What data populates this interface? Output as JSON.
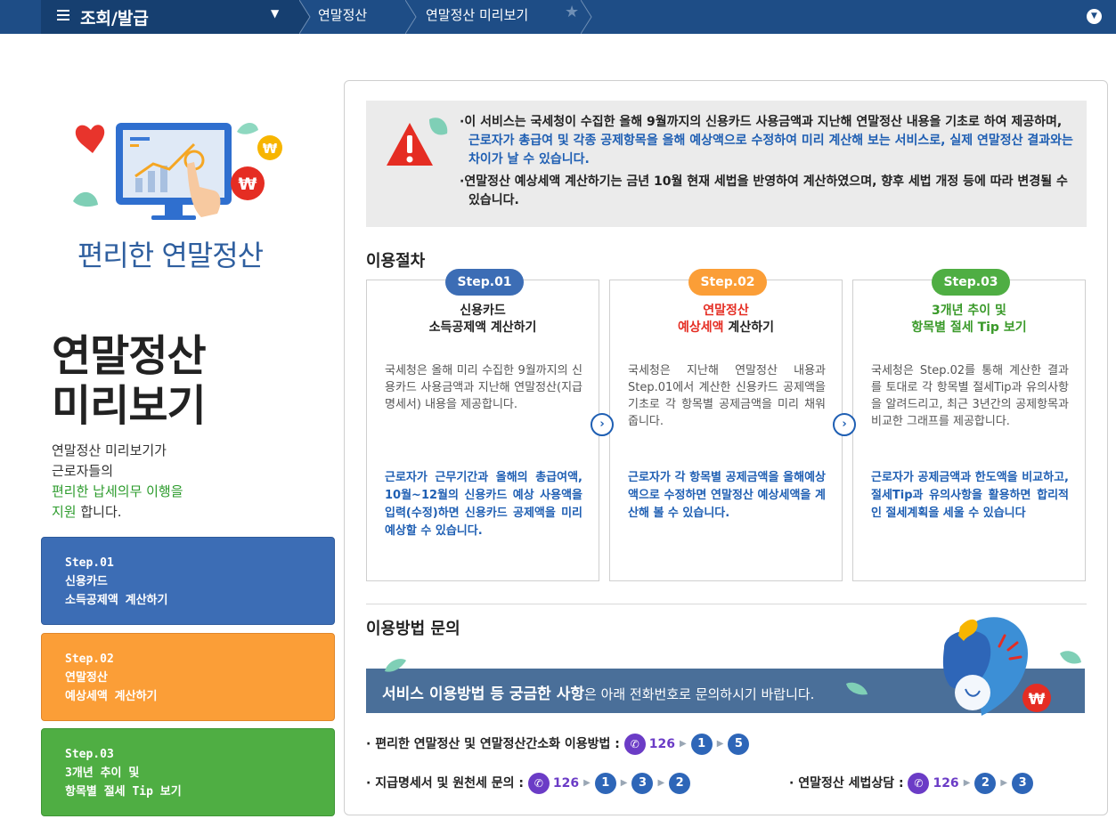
{
  "nav": {
    "menu_title": "조회/발급",
    "breadcrumbs": [
      "연말정산",
      "연말정산 미리보기"
    ]
  },
  "sidebar": {
    "promo_caption": "편리한 연말정산",
    "title_line1": "연말정산",
    "title_line2": "미리보기",
    "desc_line1": "연말정산 미리보기가",
    "desc_line2": "근로자들의",
    "desc_highlight1": "편리한 납세의무 이행을",
    "desc_highlight2": "지원",
    "desc_tail": " 합니다.",
    "steps": [
      {
        "line1": "Step.01",
        "line2": "신용카드",
        "line3": "소득공제액 계산하기"
      },
      {
        "line1": "Step.02",
        "line2": "연말정산",
        "line3": "예상세액 계산하기"
      },
      {
        "line1": "Step.03",
        "line2": "3개년 추이 및",
        "line3": "항목별 절세 Tip 보기"
      }
    ]
  },
  "notice": {
    "line1_a": "·이 서비스는 국세청이 수집한 올해 9월까지의 신용카드 사용금액과 지난해 연말정산 내용을 기초로 하여 제공하며, ",
    "line1_b": "근로자가 총급여 및 각종 공제항목을 올해 예상액으로 수정하여 미리 계산해 보는 서비스로, 실제 연말정산 결과와는 차이가 날 수 있습니다.",
    "line2": "·연말정산 예상세액 계산하기는 금년 10월 현재 세법을 반영하여 계산하였으며, 향후 세법 개정 등에 따라 변경될 수 있습니다."
  },
  "procedure": {
    "title": "이용절차",
    "cards": [
      {
        "pill": "Step.01",
        "title_line1": "신용카드",
        "title_line2": "소득공제액 계산하기",
        "body": "국세청은 올해 미리 수집한 9월까지의 신용카드 사용금액과 지난해 연말정산(지급명세서) 내용을 제공합니다.",
        "note": "근로자가 근무기간과 올해의 총급여액, 10월~12월의 신용카드 예상 사용액을 입력(수정)하면 신용카드 공제액을 미리 예상할 수 있습니다."
      },
      {
        "pill": "Step.02",
        "title_line1": "연말정산",
        "title_line2_hl": "예상세액",
        "title_line2_rest": " 계산하기",
        "body": "국세청은 지난해 연말정산 내용과 Step.01에서 계산한 신용카드 공제액을 기초로 각 항목별 공제금액을 미리 채워줍니다.",
        "note": "근로자가 각 항목별 공제금액을 올해예상액으로 수정하면 연말정산 예상세액을 계산해 볼 수 있습니다."
      },
      {
        "pill": "Step.03",
        "title_line1": "3개년 추이 및",
        "title_line2": "항목별 절세 Tip 보기",
        "body": "국세청은 Step.02를 통해 계산한 결과를 토대로 각 항목별 절세Tip과 유의사항을 알려드리고, 최근 3년간의 공제항목과 비교한 그래프를 제공합니다.",
        "note": "근로자가 공제금액과 한도액을 비교하고, 절세Tip과 유의사항을 활용하면 합리적인 절세계획을 세울 수 있습니다"
      }
    ]
  },
  "inquiry": {
    "title": "이용방법 문의",
    "banner_bold": "서비스 이용방법 등 궁금한 사항",
    "banner_rest": "은 아래 전화번호로 문의하시기 바랍니다.",
    "contacts": [
      {
        "label": "· 편리한 연말정산 및 연말정산간소화 이용방법 : ",
        "number": "126",
        "digits": [
          "1",
          "5"
        ]
      },
      {
        "label": "· 지급명세서  및 원천세 문의 : ",
        "number": "126",
        "digits": [
          "1",
          "3",
          "2"
        ]
      },
      {
        "label": "· 연말정산 세법상담  : ",
        "number": "126",
        "digits": [
          "2",
          "3"
        ]
      }
    ]
  }
}
